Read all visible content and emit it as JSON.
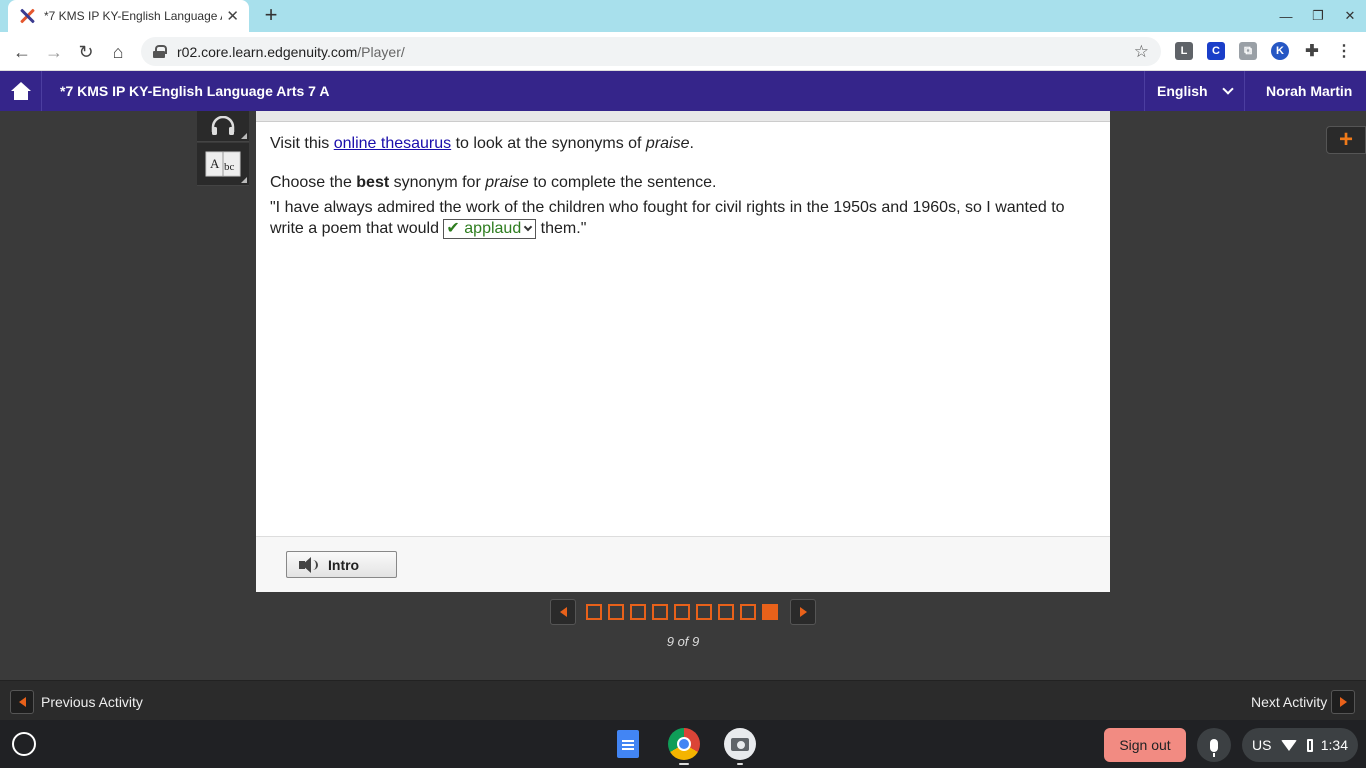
{
  "browser": {
    "tab_title": "*7 KMS IP KY-English Language Arts 7 A",
    "url_host": "r02.core.learn.edgenuity.com",
    "url_path": "/Player/",
    "extensions": [
      {
        "letter": "L",
        "color": "#5f6368"
      },
      {
        "letter": "C",
        "color": "#1a3ec9"
      },
      {
        "letter": "K",
        "color": "#2657c4"
      }
    ]
  },
  "header": {
    "course_title": "*7 KMS IP KY-English Language Arts 7 A",
    "language": "English",
    "user_name": "Norah Martin"
  },
  "question": {
    "line1_prefix": "Visit this ",
    "line1_link": "online thesaurus",
    "line1_middle": " to look at the synonyms of ",
    "line1_word": "praise",
    "line1_end": ".",
    "line2_prefix": "Choose the ",
    "line2_bold": "best",
    "line2_middle": " synonym for ",
    "line2_word": "praise",
    "line2_end": " to complete the sentence.",
    "sentence_start": "\"I have always admired the work of the children who fought for civil rights in the 1950s and 1960s, so I wanted to write a poem that would ",
    "answer_check": "✔",
    "answer_value": "applaud",
    "sentence_end": " them.\""
  },
  "footer": {
    "intro_label": "Intro"
  },
  "pager": {
    "total": 9,
    "current": 9,
    "label": "9 of 9"
  },
  "activity": {
    "previous_label": "Previous Activity",
    "next_label": "Next Activity"
  },
  "shelf": {
    "signout_label": "Sign out",
    "keyboard": "US",
    "time": "1:34"
  },
  "colors": {
    "course_bar": "#35258a",
    "accent_orange": "#e8611a",
    "answer_green": "#2e7d1f",
    "signout": "#f28b82"
  }
}
